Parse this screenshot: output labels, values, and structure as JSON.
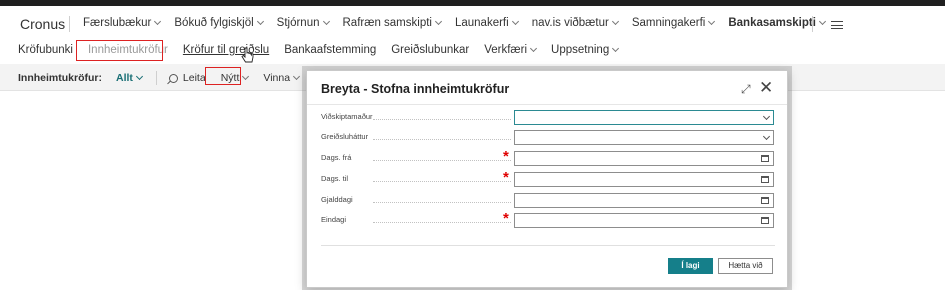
{
  "header": {
    "company": "Cronus",
    "nav_items": [
      {
        "label": "Færslubækur",
        "has_dropdown": true
      },
      {
        "label": "Bókuð fylgiskjöl",
        "has_dropdown": true
      },
      {
        "label": "Stjórnun",
        "has_dropdown": true
      },
      {
        "label": "Rafræn samskipti",
        "has_dropdown": true
      },
      {
        "label": "Launakerfi",
        "has_dropdown": true
      },
      {
        "label": "nav.is viðbætur",
        "has_dropdown": true
      },
      {
        "label": "Samningakerfi",
        "has_dropdown": true
      },
      {
        "label": "Bankasamskipti",
        "has_dropdown": true,
        "active": true
      }
    ],
    "menu_icon": "hamburger-icon"
  },
  "subnav": {
    "items": [
      {
        "label": "Kröfubunki"
      },
      {
        "label": "Innheimtukröfur",
        "state": "faded",
        "highlighted": true
      },
      {
        "label": "Kröfur til greiðslu",
        "state": "hovered"
      },
      {
        "label": "Bankaafstemming"
      },
      {
        "label": "Greiðslubunkar"
      },
      {
        "label": "Verkfæri",
        "has_dropdown": true
      },
      {
        "label": "Uppsetning",
        "has_dropdown": true
      }
    ]
  },
  "actionbar": {
    "page_title": "Innheimtukröfur:",
    "filter_label": "Allt",
    "search_label": "Leita",
    "new_label": "Nýtt",
    "process_label": "Vinna"
  },
  "dialog": {
    "title": "Breyta - Stofna innheimtukröfur",
    "fields": [
      {
        "label": "Viðskiptamaður",
        "value": "",
        "type": "dropdown",
        "required": false
      },
      {
        "label": "Greiðsluháttur",
        "value": "",
        "type": "dropdown",
        "required": false
      },
      {
        "label": "Dags. frá",
        "value": "",
        "type": "date",
        "required": true
      },
      {
        "label": "Dags. til",
        "value": "",
        "type": "date",
        "required": true
      },
      {
        "label": "Gjalddagi",
        "value": "",
        "type": "date",
        "required": false
      },
      {
        "label": "Eindagi",
        "value": "",
        "type": "date",
        "required": true
      }
    ],
    "ok_label": "Í lagi",
    "cancel_label": "Hætta við",
    "colors": {
      "accent": "#157f8a",
      "required": "#e00000",
      "highlight": "#d22222"
    }
  }
}
